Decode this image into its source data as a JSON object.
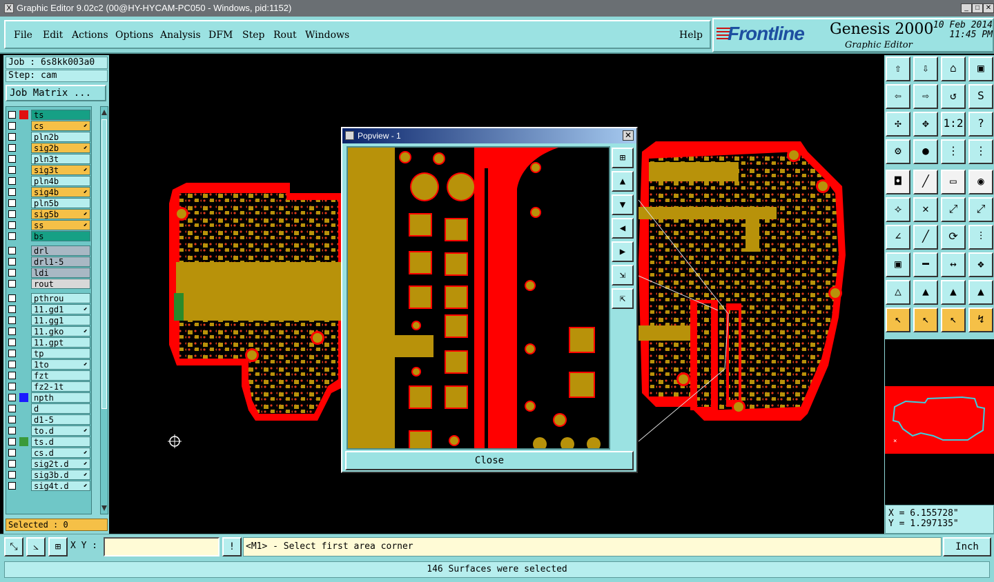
{
  "window": {
    "title": "Graphic Editor 9.02c2 (00@HY-HYCAM-PC050 - Windows, pid:1152)"
  },
  "menu": {
    "items": [
      "File",
      "Edit",
      "Actions",
      "Options",
      "Analysis",
      "DFM",
      "Step",
      "Rout",
      "Windows"
    ],
    "help": "Help"
  },
  "brand": {
    "logo": "Frontline",
    "product": "Genesis 2000",
    "subtitle": "Graphic Editor",
    "date": "10 Feb 2014",
    "time": "11:45 PM"
  },
  "job": {
    "job_label": "Job : 6s8kk003a0",
    "step_label": "Step: cam",
    "matrix_button": "Job Matrix ..."
  },
  "layers": [
    {
      "name": "ts",
      "color": "#16a085",
      "swatch": "#e01010",
      "arrow": ""
    },
    {
      "name": "cs",
      "color": "#f5c047",
      "swatch": "",
      "arrow": "⬋"
    },
    {
      "name": "pln2b",
      "color": "#b6eeee",
      "swatch": "",
      "arrow": ""
    },
    {
      "name": "sig2b",
      "color": "#f5c047",
      "swatch": "",
      "arrow": "⬋"
    },
    {
      "name": "pln3t",
      "color": "#b6eeee",
      "swatch": "",
      "arrow": ""
    },
    {
      "name": "sig3t",
      "color": "#f5c047",
      "swatch": "",
      "arrow": "⬋"
    },
    {
      "name": "pln4b",
      "color": "#b6eeee",
      "swatch": "",
      "arrow": ""
    },
    {
      "name": "sig4b",
      "color": "#f5c047",
      "swatch": "",
      "arrow": "⬋"
    },
    {
      "name": "pln5b",
      "color": "#b6eeee",
      "swatch": "",
      "arrow": ""
    },
    {
      "name": "sig5b",
      "color": "#f5c047",
      "swatch": "",
      "arrow": "⬋"
    },
    {
      "name": "ss",
      "color": "#f5c047",
      "swatch": "",
      "arrow": "⬋"
    },
    {
      "name": "bs",
      "color": "#16a085",
      "swatch": "",
      "arrow": ""
    },
    {
      "name": "drl",
      "color": "#a9b8c4",
      "swatch": "",
      "arrow": ""
    },
    {
      "name": "drl1-5",
      "color": "#a9b8c4",
      "swatch": "",
      "arrow": ""
    },
    {
      "name": "ldi",
      "color": "#a9b8c4",
      "swatch": "",
      "arrow": ""
    },
    {
      "name": "rout",
      "color": "#d8d8d8",
      "swatch": "",
      "arrow": ""
    },
    {
      "name": "pthrou",
      "color": "#b6eeee",
      "swatch": "",
      "arrow": ""
    },
    {
      "name": "11.gd1",
      "color": "#b6eeee",
      "swatch": "",
      "arrow": "⬋"
    },
    {
      "name": "11.gg1",
      "color": "#b6eeee",
      "swatch": "",
      "arrow": ""
    },
    {
      "name": "11.gko",
      "color": "#b6eeee",
      "swatch": "",
      "arrow": "⬋"
    },
    {
      "name": "11.gpt",
      "color": "#b6eeee",
      "swatch": "",
      "arrow": ""
    },
    {
      "name": "tp",
      "color": "#b6eeee",
      "swatch": "",
      "arrow": ""
    },
    {
      "name": "1to",
      "color": "#b6eeee",
      "swatch": "",
      "arrow": "⬋"
    },
    {
      "name": "fzt",
      "color": "#b6eeee",
      "swatch": "",
      "arrow": ""
    },
    {
      "name": "fz2-1t",
      "color": "#b6eeee",
      "swatch": "",
      "arrow": ""
    },
    {
      "name": "npth",
      "color": "#b6eeee",
      "swatch": "#1a1aff",
      "arrow": ""
    },
    {
      "name": "d",
      "color": "#b6eeee",
      "swatch": "",
      "arrow": ""
    },
    {
      "name": "d1-5",
      "color": "#b6eeee",
      "swatch": "",
      "arrow": ""
    },
    {
      "name": "to.d",
      "color": "#b6eeee",
      "swatch": "",
      "arrow": "⬋"
    },
    {
      "name": "ts.d",
      "color": "#b6eeee",
      "swatch": "#3a9a3a",
      "arrow": ""
    },
    {
      "name": "cs.d",
      "color": "#b6eeee",
      "swatch": "",
      "arrow": "⬋"
    },
    {
      "name": "sig2t.d",
      "color": "#b6eeee",
      "swatch": "",
      "arrow": "⬋"
    },
    {
      "name": "sig3b.d",
      "color": "#b6eeee",
      "swatch": "",
      "arrow": "⬋"
    },
    {
      "name": "sig4t.d",
      "color": "#b6eeee",
      "swatch": "",
      "arrow": "⬋"
    }
  ],
  "selected": "Selected : 0",
  "popview": {
    "title": "Popview - 1",
    "close_label": "Close"
  },
  "coords": {
    "x": "X =  6.155728\"",
    "y": "Y =  1.297135\""
  },
  "bottom": {
    "xy_label": "X Y :",
    "xy_value": "",
    "prompt": "<M1> - Select first area corner",
    "units": "Inch"
  },
  "status": "146 Surfaces were selected",
  "colors": {
    "copper": "#b8920a",
    "soldermask": "#ff0000",
    "panel": "#8fd8d8"
  }
}
